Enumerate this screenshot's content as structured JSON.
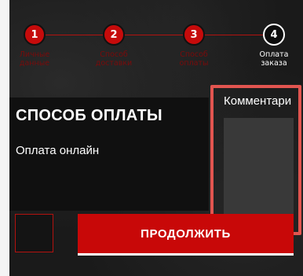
{
  "steps": [
    {
      "number": "1",
      "label": "Личные данные",
      "active": false
    },
    {
      "number": "2",
      "label": "Способ доставки",
      "active": false
    },
    {
      "number": "3",
      "label": "Способ оплаты",
      "active": false
    },
    {
      "number": "4",
      "label": "Оплата заказа",
      "active": true
    }
  ],
  "payment": {
    "title": "СПОСОБ ОПЛАТЫ",
    "option": "Оплата онлайн"
  },
  "comment": {
    "label": "Комментари",
    "value": ""
  },
  "continue_label": "ПРОДОЛЖИТЬ",
  "colors": {
    "accent": "#c80808",
    "highlight": "#e25550"
  }
}
